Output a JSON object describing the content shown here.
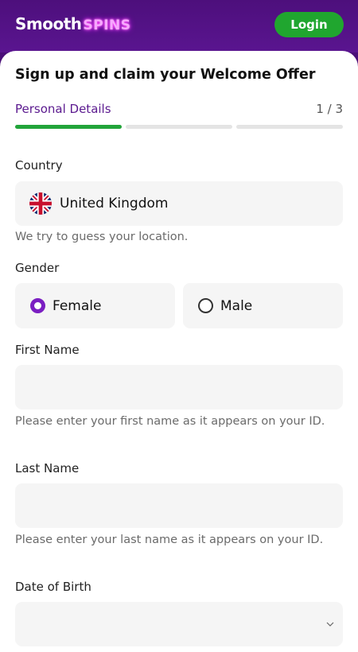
{
  "header": {
    "logo_part1": "Smooth",
    "logo_part2": "SPINS",
    "login_label": "Login"
  },
  "form": {
    "title": "Sign up and claim your Welcome Offer",
    "step_label": "Personal Details",
    "step_count": "1 / 3",
    "progress": {
      "current": 1,
      "total": 3
    },
    "country": {
      "label": "Country",
      "value": "United Kingdom",
      "flag_icon": "uk-flag-icon",
      "helper": "We try to guess your location."
    },
    "gender": {
      "label": "Gender",
      "options": [
        {
          "label": "Female",
          "selected": true
        },
        {
          "label": "Male",
          "selected": false
        }
      ]
    },
    "first_name": {
      "label": "First Name",
      "value": "",
      "helper": "Please enter your first name as it appears on your ID."
    },
    "last_name": {
      "label": "Last Name",
      "value": "",
      "helper": "Please enter your last name as it appears on your ID."
    },
    "dob": {
      "label": "Date of Birth",
      "value": ""
    }
  },
  "colors": {
    "header_bg": "#4d0f7c",
    "login_green": "#20a62f",
    "accent_purple": "#7b1fc2",
    "progress_green": "#22a43a",
    "field_bg": "#f5f5f5"
  }
}
